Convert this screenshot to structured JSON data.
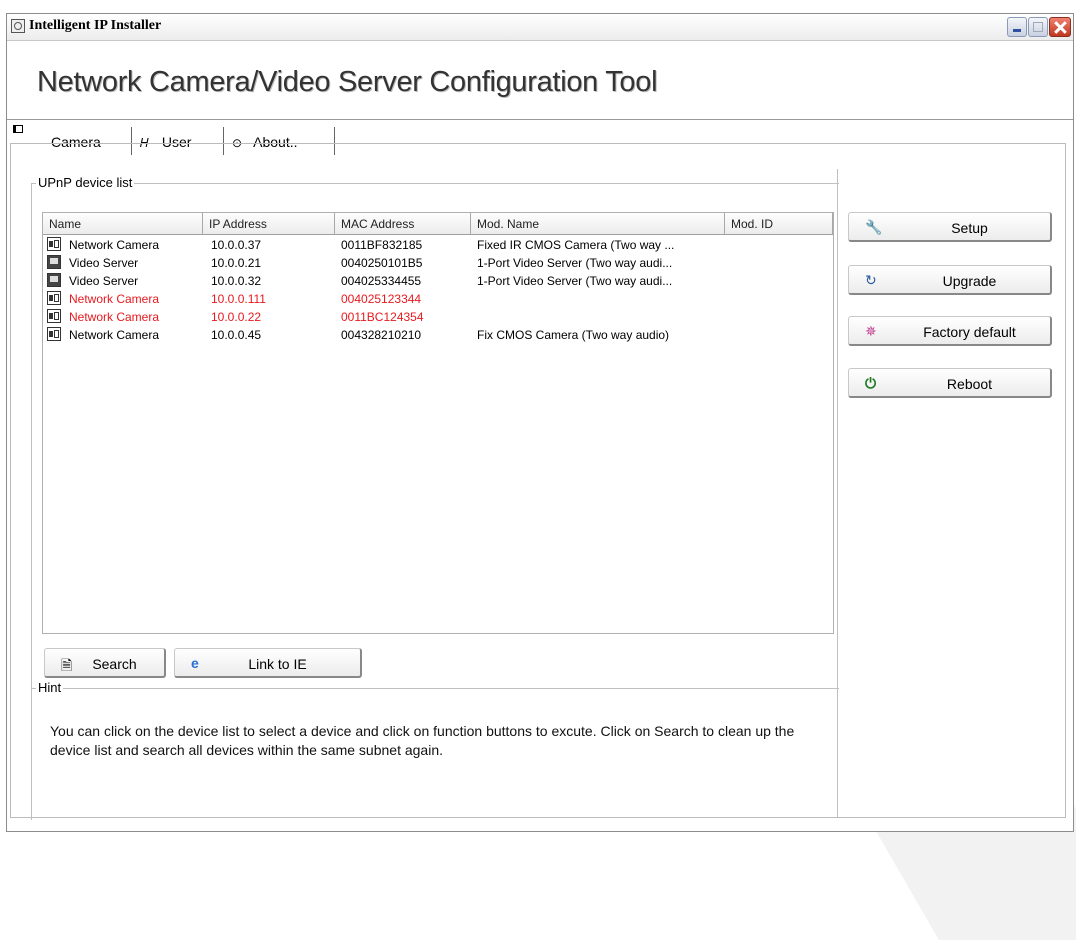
{
  "window": {
    "title": "Intelligent IP Installer"
  },
  "header": {
    "heading": "Network Camera/Video Server Configuration Tool"
  },
  "tabs": [
    {
      "label": "Camera",
      "icon": "camera-icon"
    },
    {
      "label": "User",
      "icon": "user-icon"
    },
    {
      "label": "About..",
      "icon": "info-icon"
    }
  ],
  "upnp": {
    "group_label": "UPnP device list",
    "columns": [
      "Name",
      "IP Address",
      "MAC Address",
      "Mod. Name",
      "Mod. ID"
    ],
    "rows": [
      {
        "icon": "camera",
        "name": "Network Camera",
        "ip": "10.0.0.37",
        "mac": "0011BF832185",
        "model": "Fixed IR CMOS Camera (Two way ...",
        "mod_id": "",
        "color": "#000000"
      },
      {
        "icon": "server",
        "name": "Video Server",
        "ip": "10.0.0.21",
        "mac": "0040250101B5",
        "model": "1-Port Video Server (Two way audi...",
        "mod_id": "",
        "color": "#000000"
      },
      {
        "icon": "server",
        "name": "Video Server",
        "ip": "10.0.0.32",
        "mac": "004025334455",
        "model": "1-Port Video Server (Two way audi...",
        "mod_id": "",
        "color": "#000000"
      },
      {
        "icon": "camera",
        "name": "Network Camera",
        "ip": "10.0.0.111",
        "mac": "004025123344",
        "model": "",
        "mod_id": "",
        "color": "#e8191e"
      },
      {
        "icon": "camera",
        "name": "Network Camera",
        "ip": "10.0.0.22",
        "mac": "0011BC124354",
        "model": "",
        "mod_id": "",
        "color": "#e8191e"
      },
      {
        "icon": "camera",
        "name": "Network Camera",
        "ip": "10.0.0.45",
        "mac": "004328210210",
        "model": "Fix CMOS Camera (Two way audio)",
        "mod_id": "",
        "color": "#000000"
      }
    ]
  },
  "buttons": {
    "search": "Search",
    "link_ie": "Link to IE",
    "setup": "Setup",
    "upgrade": "Upgrade",
    "factory_default": "Factory default",
    "reboot": "Reboot"
  },
  "hint": {
    "group_label": "Hint",
    "text": "You can click on the device list to select a device and click on function buttons to excute. Click on Search to clean up the device list and search all devices  within the same subnet again."
  },
  "colors": {
    "highlight_row_text": "#e8191e",
    "ie_icon": "#2a6fd6",
    "setup_icon": "#3a7ac8",
    "reboot_icon": "#1a7a20"
  }
}
